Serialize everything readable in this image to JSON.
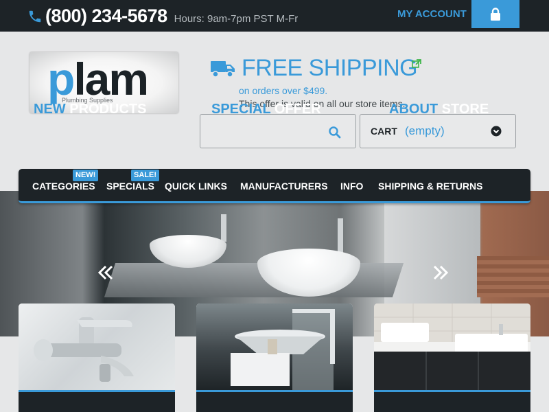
{
  "topbar": {
    "phone": "(800) 234-5678",
    "hours": "Hours: 9am-7pm PST M-Fr",
    "my_account": "MY ACCOUNT",
    "phone_icon": "phone-icon",
    "lock_icon": "lock-icon"
  },
  "logo": {
    "main_first": "p",
    "main_rest": "lam",
    "subtitle": "Plumbing Supplies"
  },
  "promo": {
    "title": "FREE SHIPPING",
    "subtitle": "on orders over $499.",
    "note": "This offer is valid on all our store items."
  },
  "search": {
    "placeholder": "",
    "value": ""
  },
  "cart": {
    "label": "CART",
    "status": "(empty)"
  },
  "nav": {
    "items": [
      {
        "label": "CATEGORIES",
        "badge": "NEW!"
      },
      {
        "label": "SPECIALS",
        "badge": "SALE!"
      },
      {
        "label": "QUICK LINKS"
      },
      {
        "label": "MANUFACTURERS"
      },
      {
        "label": "INFO"
      },
      {
        "label": "SHIPPING & RETURNS"
      }
    ]
  },
  "cards": [
    {
      "title_highlight": "NEW",
      "title_rest": " PRODUCTS"
    },
    {
      "title_highlight": "SPECIAL",
      "title_rest": " OFFER"
    },
    {
      "title_highlight": "ABOUT",
      "title_rest": " STORE"
    }
  ],
  "colors": {
    "accent": "#3a9ad9",
    "dark": "#1d2327",
    "background": "#e6e7e8"
  }
}
